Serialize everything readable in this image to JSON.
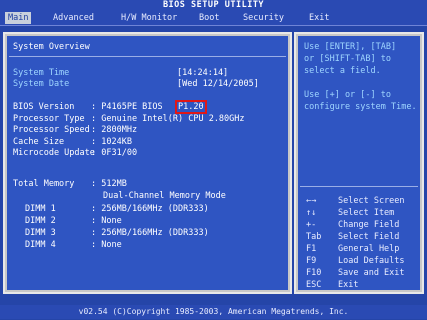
{
  "title": "BIOS SETUP UTILITY",
  "menu": {
    "items": [
      {
        "label": "Main",
        "active": true
      },
      {
        "label": "Advanced",
        "active": false
      },
      {
        "label": "H/W Monitor",
        "active": false
      },
      {
        "label": "Boot",
        "active": false
      },
      {
        "label": "Security",
        "active": false
      },
      {
        "label": "Exit",
        "active": false
      }
    ]
  },
  "main": {
    "section_title": "System Overview",
    "system_time_label": "System Time",
    "system_time_value": "[14:24:14]",
    "system_date_label": "System Date",
    "system_date_value": "[Wed 12/14/2005]",
    "bios_version_label": "BIOS Version",
    "bios_version_value": ": P4165PE BIOS",
    "bios_version_highlight": "P1.20",
    "processor_type_label": "Processor Type",
    "processor_type_value": ": Genuine Intel(R) CPU 2.80GHz",
    "processor_speed_label": "Processor Speed",
    "processor_speed_value": ": 2800MHz",
    "cache_size_label": "Cache Size",
    "cache_size_value": ": 1024KB",
    "microcode_label": "Microcode Update",
    "microcode_value": ": 0F31/00",
    "total_memory_label": "Total Memory",
    "total_memory_value": ": 512MB",
    "memory_mode": "Dual-Channel Memory Mode",
    "dimms": [
      {
        "label": "DIMM 1",
        "value": ": 256MB/166MHz (DDR333)"
      },
      {
        "label": "DIMM 2",
        "value": ": None"
      },
      {
        "label": "DIMM 3",
        "value": ": 256MB/166MHz (DDR333)"
      },
      {
        "label": "DIMM 4",
        "value": ": None"
      }
    ]
  },
  "help": {
    "line1": "Use [ENTER], [TAB]",
    "line2": "or [SHIFT-TAB] to",
    "line3": "select a field.",
    "line4": "Use [+] or [-] to",
    "line5": "configure system Time."
  },
  "keys": [
    {
      "key": "←→",
      "desc": "Select Screen"
    },
    {
      "key": "↑↓",
      "desc": "Select Item"
    },
    {
      "key": "+-",
      "desc": "Change Field"
    },
    {
      "key": "Tab",
      "desc": "Select Field"
    },
    {
      "key": "F1",
      "desc": "General Help"
    },
    {
      "key": "F9",
      "desc": "Load Defaults"
    },
    {
      "key": "F10",
      "desc": "Save and Exit"
    },
    {
      "key": "ESC",
      "desc": "Exit"
    }
  ],
  "footer": "v02.54 (C)Copyright 1985-2003, American Megatrends, Inc."
}
